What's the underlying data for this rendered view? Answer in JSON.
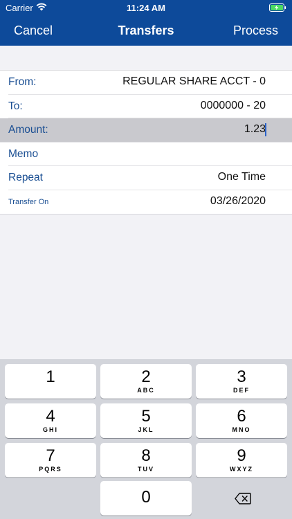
{
  "status_bar": {
    "carrier": "Carrier",
    "time": "11:24 AM"
  },
  "nav": {
    "cancel": "Cancel",
    "title": "Transfers",
    "process": "Process"
  },
  "form": {
    "from_label": "From:",
    "from_value": "REGULAR SHARE ACCT - 0",
    "to_label": "To:",
    "to_value": "0000000 - 20",
    "amount_label": "Amount:",
    "amount_value": "1.23",
    "memo_label": "Memo",
    "memo_value": "",
    "repeat_label": "Repeat",
    "repeat_value": "One Time",
    "transfer_on_label": "Transfer On",
    "transfer_on_value": "03/26/2020"
  },
  "keyboard": {
    "keys": [
      {
        "num": "1",
        "letters": ""
      },
      {
        "num": "2",
        "letters": "ABC"
      },
      {
        "num": "3",
        "letters": "DEF"
      },
      {
        "num": "4",
        "letters": "GHI"
      },
      {
        "num": "5",
        "letters": "JKL"
      },
      {
        "num": "6",
        "letters": "MNO"
      },
      {
        "num": "7",
        "letters": "PQRS"
      },
      {
        "num": "8",
        "letters": "TUV"
      },
      {
        "num": "9",
        "letters": "WXYZ"
      },
      {
        "num": "0",
        "letters": ""
      }
    ]
  },
  "colors": {
    "nav_bg": "#0d4a9a",
    "label": "#1b4f93",
    "highlight_row": "#c9c9ce",
    "keyboard_bg": "#d3d5db"
  },
  "icons": {
    "wifi": "wifi-icon",
    "battery": "battery-charging-icon",
    "backspace": "backspace-icon"
  }
}
